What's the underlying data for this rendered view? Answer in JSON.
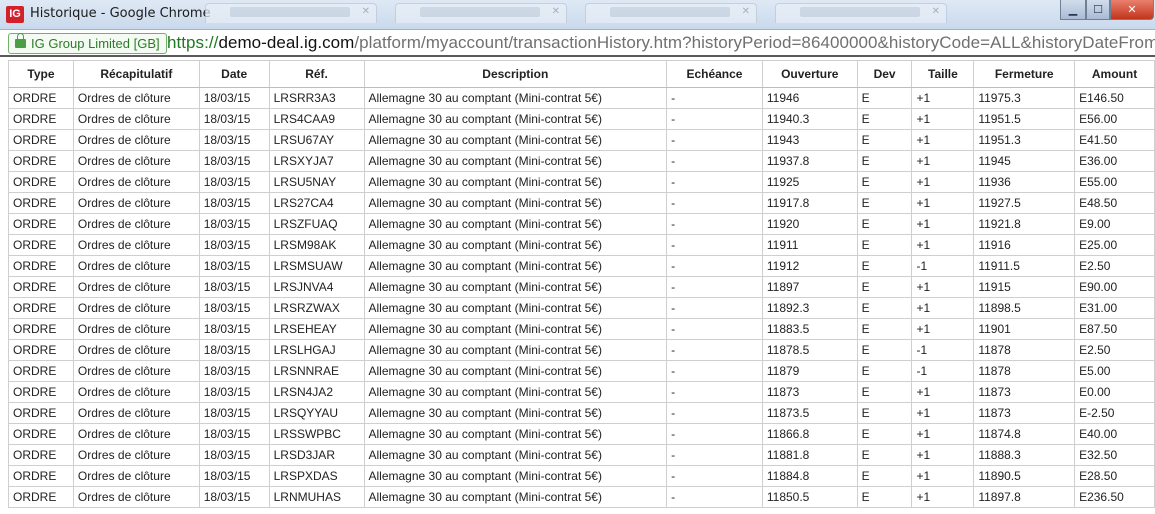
{
  "window": {
    "title": "Historique - Google Chrome",
    "app_icon": "IG",
    "minimize_icon": "minimize-icon",
    "maximize_icon": "maximize-icon",
    "close_icon": "close-icon"
  },
  "address": {
    "ev_label": "IG Group Limited [GB]",
    "scheme": "https://",
    "host": "demo-deal.ig.com",
    "path": "/platform/myaccount/transactionHistory.htm?historyPeriod=86400000&historyCode=ALL&historyDateFrom=TOD/"
  },
  "table": {
    "columns": [
      "Type",
      "Récapitulatif",
      "Date",
      "Réf.",
      "Description",
      "Echéance",
      "Ouverture",
      "Dev",
      "Taille",
      "Fermeture",
      "Amount"
    ],
    "rows": [
      [
        "ORDRE",
        "Ordres de clôture",
        "18/03/15",
        "LRSRR3A3",
        "Allemagne 30 au comptant (Mini-contrat 5€)",
        "-",
        "11946",
        "E",
        "+1",
        "11975.3",
        "E146.50"
      ],
      [
        "ORDRE",
        "Ordres de clôture",
        "18/03/15",
        "LRS4CAA9",
        "Allemagne 30 au comptant (Mini-contrat 5€)",
        "-",
        "11940.3",
        "E",
        "+1",
        "11951.5",
        "E56.00"
      ],
      [
        "ORDRE",
        "Ordres de clôture",
        "18/03/15",
        "LRSU67AY",
        "Allemagne 30 au comptant (Mini-contrat 5€)",
        "-",
        "11943",
        "E",
        "+1",
        "11951.3",
        "E41.50"
      ],
      [
        "ORDRE",
        "Ordres de clôture",
        "18/03/15",
        "LRSXYJA7",
        "Allemagne 30 au comptant (Mini-contrat 5€)",
        "-",
        "11937.8",
        "E",
        "+1",
        "11945",
        "E36.00"
      ],
      [
        "ORDRE",
        "Ordres de clôture",
        "18/03/15",
        "LRSU5NAY",
        "Allemagne 30 au comptant (Mini-contrat 5€)",
        "-",
        "11925",
        "E",
        "+1",
        "11936",
        "E55.00"
      ],
      [
        "ORDRE",
        "Ordres de clôture",
        "18/03/15",
        "LRS27CA4",
        "Allemagne 30 au comptant (Mini-contrat 5€)",
        "-",
        "11917.8",
        "E",
        "+1",
        "11927.5",
        "E48.50"
      ],
      [
        "ORDRE",
        "Ordres de clôture",
        "18/03/15",
        "LRSZFUAQ",
        "Allemagne 30 au comptant (Mini-contrat 5€)",
        "-",
        "11920",
        "E",
        "+1",
        "11921.8",
        "E9.00"
      ],
      [
        "ORDRE",
        "Ordres de clôture",
        "18/03/15",
        "LRSM98AK",
        "Allemagne 30 au comptant (Mini-contrat 5€)",
        "-",
        "11911",
        "E",
        "+1",
        "11916",
        "E25.00"
      ],
      [
        "ORDRE",
        "Ordres de clôture",
        "18/03/15",
        "LRSMSUAW",
        "Allemagne 30 au comptant (Mini-contrat 5€)",
        "-",
        "11912",
        "E",
        "-1",
        "11911.5",
        "E2.50"
      ],
      [
        "ORDRE",
        "Ordres de clôture",
        "18/03/15",
        "LRSJNVA4",
        "Allemagne 30 au comptant (Mini-contrat 5€)",
        "-",
        "11897",
        "E",
        "+1",
        "11915",
        "E90.00"
      ],
      [
        "ORDRE",
        "Ordres de clôture",
        "18/03/15",
        "LRSRZWAX",
        "Allemagne 30 au comptant (Mini-contrat 5€)",
        "-",
        "11892.3",
        "E",
        "+1",
        "11898.5",
        "E31.00"
      ],
      [
        "ORDRE",
        "Ordres de clôture",
        "18/03/15",
        "LRSEHEAY",
        "Allemagne 30 au comptant (Mini-contrat 5€)",
        "-",
        "11883.5",
        "E",
        "+1",
        "11901",
        "E87.50"
      ],
      [
        "ORDRE",
        "Ordres de clôture",
        "18/03/15",
        "LRSLHGAJ",
        "Allemagne 30 au comptant (Mini-contrat 5€)",
        "-",
        "11878.5",
        "E",
        "-1",
        "11878",
        "E2.50"
      ],
      [
        "ORDRE",
        "Ordres de clôture",
        "18/03/15",
        "LRSNNRAE",
        "Allemagne 30 au comptant (Mini-contrat 5€)",
        "-",
        "11879",
        "E",
        "-1",
        "11878",
        "E5.00"
      ],
      [
        "ORDRE",
        "Ordres de clôture",
        "18/03/15",
        "LRSN4JA2",
        "Allemagne 30 au comptant (Mini-contrat 5€)",
        "-",
        "11873",
        "E",
        "+1",
        "11873",
        "E0.00"
      ],
      [
        "ORDRE",
        "Ordres de clôture",
        "18/03/15",
        "LRSQYYAU",
        "Allemagne 30 au comptant (Mini-contrat 5€)",
        "-",
        "11873.5",
        "E",
        "+1",
        "11873",
        "E-2.50"
      ],
      [
        "ORDRE",
        "Ordres de clôture",
        "18/03/15",
        "LRSSWPBC",
        "Allemagne 30 au comptant (Mini-contrat 5€)",
        "-",
        "11866.8",
        "E",
        "+1",
        "11874.8",
        "E40.00"
      ],
      [
        "ORDRE",
        "Ordres de clôture",
        "18/03/15",
        "LRSD3JAR",
        "Allemagne 30 au comptant (Mini-contrat 5€)",
        "-",
        "11881.8",
        "E",
        "+1",
        "11888.3",
        "E32.50"
      ],
      [
        "ORDRE",
        "Ordres de clôture",
        "18/03/15",
        "LRSPXDAS",
        "Allemagne 30 au comptant (Mini-contrat 5€)",
        "-",
        "11884.8",
        "E",
        "+1",
        "11890.5",
        "E28.50"
      ],
      [
        "ORDRE",
        "Ordres de clôture",
        "18/03/15",
        "LRNMUHAS",
        "Allemagne 30 au comptant (Mini-contrat 5€)",
        "-",
        "11850.5",
        "E",
        "+1",
        "11897.8",
        "E236.50"
      ]
    ]
  }
}
